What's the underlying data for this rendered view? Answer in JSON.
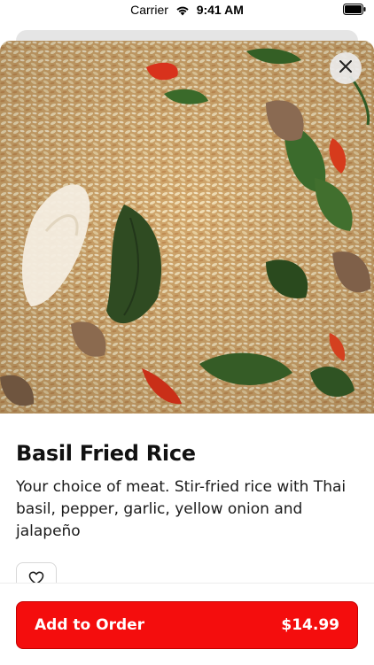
{
  "status_bar": {
    "carrier": "Carrier",
    "time": "9:41 AM",
    "wifi_icon": "wifi-icon",
    "battery_icon": "battery-icon"
  },
  "item": {
    "title": "Basil Fried Rice",
    "description": "Your choice of meat. Stir-fried rice with Thai basil, pepper, garlic, yellow onion and jalapeño",
    "image_icon": "food-photo"
  },
  "actions": {
    "close_icon": "close-icon",
    "favorite_icon": "heart-icon",
    "add_label": "Add to Order",
    "price": "$14.99"
  },
  "colors": {
    "accent": "#f40d0d",
    "accent_border": "#c40000"
  }
}
